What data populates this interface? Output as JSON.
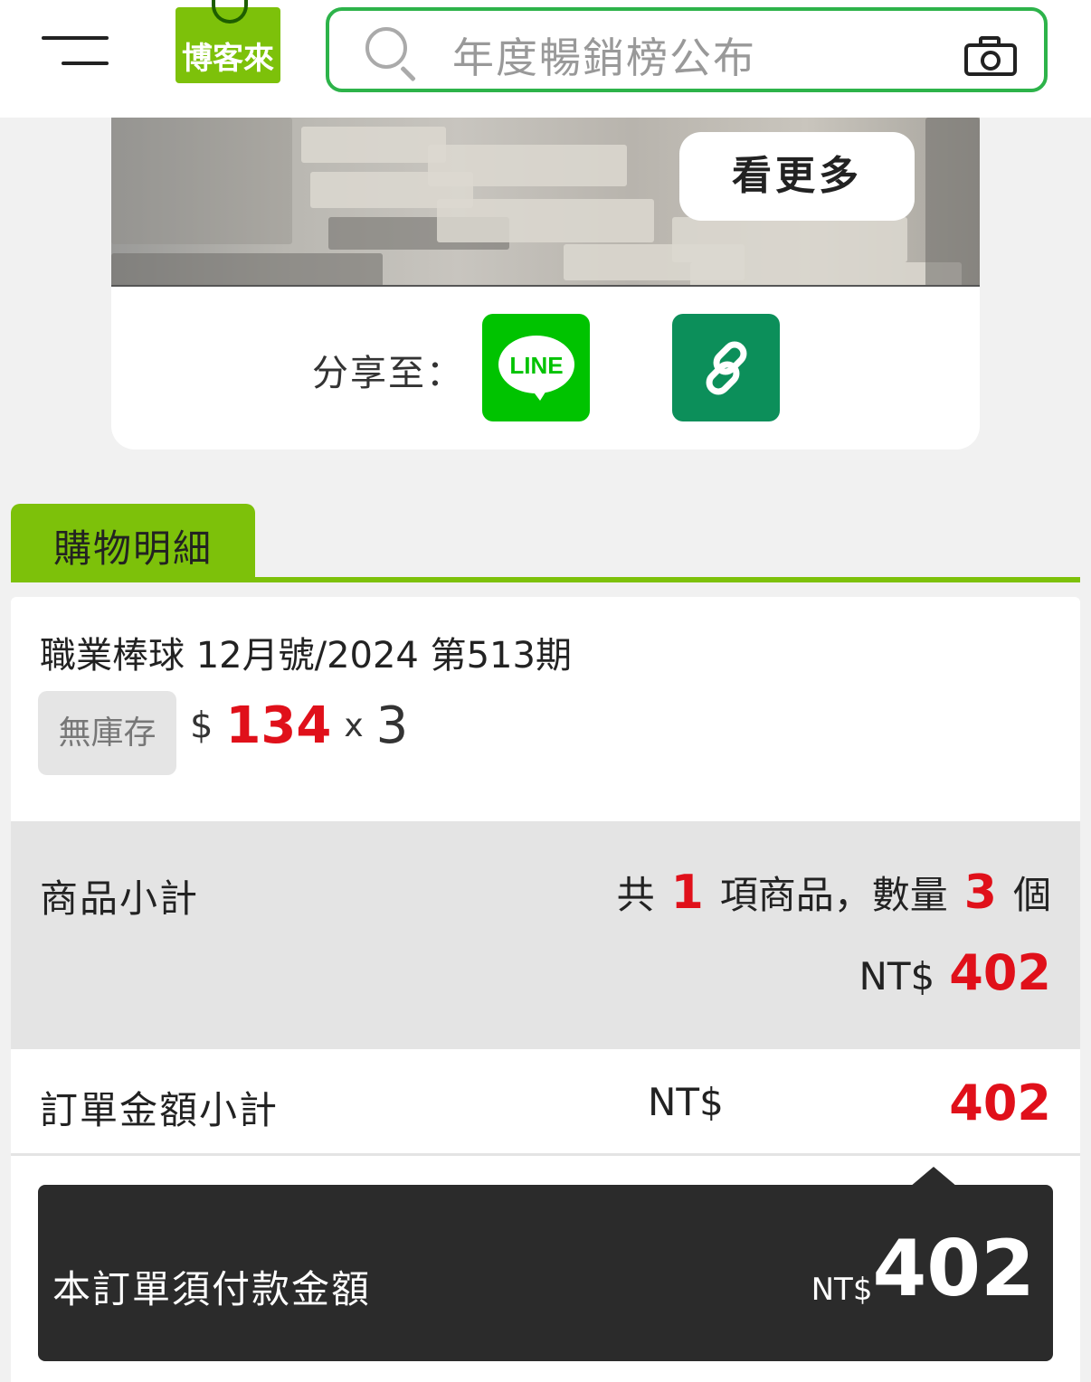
{
  "header": {
    "logo_text": "博客來",
    "search_placeholder": "年度暢銷榜公布"
  },
  "banner": {
    "see_more_label": "看更多",
    "share_label": "分享至：",
    "line_label": "LINE"
  },
  "tab": {
    "label": "購物明細"
  },
  "item": {
    "title": "職業棒球 12月號/2024 第513期",
    "stock_status": "無庫存",
    "currency_symbol": "$",
    "unit_price": "134",
    "multiply": "x",
    "quantity": "3"
  },
  "subtotal": {
    "label": "商品小計",
    "prefix": "共",
    "item_count": "1",
    "middle": "項商品，數量",
    "total_qty": "3",
    "suffix": "個",
    "currency": "NT$",
    "amount": "402"
  },
  "order_subtotal": {
    "label": "訂單金額小計",
    "currency": "NT$",
    "amount": "402"
  },
  "payment": {
    "label": "本訂單須付款金額",
    "currency": "NT$",
    "amount": "402"
  },
  "colors": {
    "brand_green": "#7dc10a",
    "search_border": "#2db34a",
    "price_red": "#e0101a",
    "line_green": "#00c300",
    "link_green": "#0c8f5a"
  }
}
